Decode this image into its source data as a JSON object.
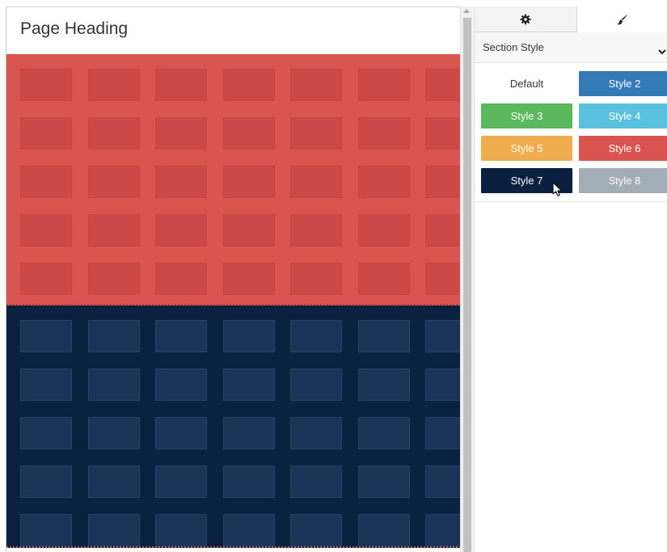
{
  "canvas": {
    "page_heading": "Page Heading",
    "sections": [
      {
        "name": "red-section",
        "color": "#da5450",
        "cell_rows": 5,
        "cell_cols": 7
      },
      {
        "name": "navy-section",
        "color": "#0b2140",
        "cell_rows": 5,
        "cell_cols": 7
      }
    ]
  },
  "panel": {
    "tabs": [
      {
        "name": "settings",
        "icon": "gear-icon",
        "active": false
      },
      {
        "name": "style",
        "icon": "paintbrush-icon",
        "active": true
      }
    ],
    "section_style_label": "Section Style",
    "section_style_icon": "chevron-down-icon",
    "style_options": [
      {
        "label": "Default",
        "color": "#ffffff",
        "text_color": "#333333"
      },
      {
        "label": "Style 2",
        "color": "#337ab7",
        "text_color": "#ffffff"
      },
      {
        "label": "Style 3",
        "color": "#5cb85c",
        "text_color": "#ffffff"
      },
      {
        "label": "Style 4",
        "color": "#5bc0de",
        "text_color": "#ffffff"
      },
      {
        "label": "Style 5",
        "color": "#f0ad4e",
        "text_color": "#ffffff"
      },
      {
        "label": "Style 6",
        "color": "#d9534f",
        "text_color": "#ffffff"
      },
      {
        "label": "Style 7",
        "color": "#0b1f3f",
        "text_color": "#ffffff"
      },
      {
        "label": "Style 8",
        "color": "#a2adb6",
        "text_color": "#ffffff"
      }
    ],
    "hovered_option": "Style 7"
  }
}
